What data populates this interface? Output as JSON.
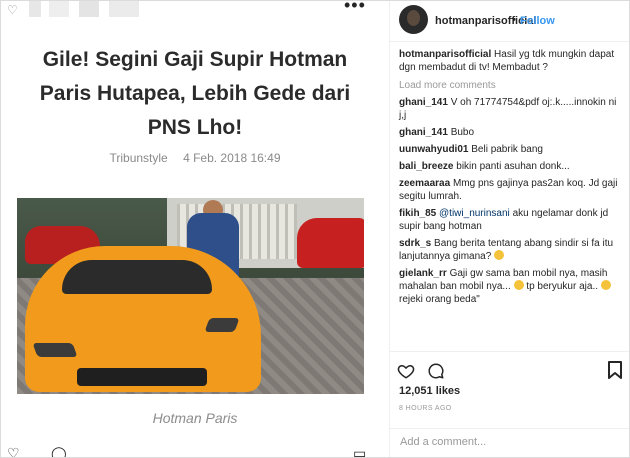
{
  "post": {
    "headline_lines": [
      "Gile! Segini Gaji Supir Hotman",
      "Paris Hutapea, Lebih Gede dari",
      "PNS Lho!"
    ],
    "source": "Tribunstyle",
    "date": "4 Feb. 2018 16:49",
    "caption": "Hotman Paris"
  },
  "header": {
    "username": "hotmanparisofficial",
    "dot": "•",
    "follow_label": "Follow"
  },
  "top_more": "•••",
  "comments": {
    "caption": {
      "user": "hotmanparisofficial",
      "text": "Hasil yg tdk mungkin dapat dgn membadut di tv! Membadut ?"
    },
    "load_more": "Load more comments",
    "items": [
      {
        "user": "ghani_141",
        "text": "V oh 71774754&pdf oj:.k.....innokin ni j,j"
      },
      {
        "user": "ghani_141",
        "text": "Bubo"
      },
      {
        "user": "uunwahyudi01",
        "text": "Beli pabrik bang"
      },
      {
        "user": "bali_breeze",
        "text": "bikin panti asuhan donk..."
      },
      {
        "user": "zeemaaraa",
        "text": "Mmg pns gajinya pas2an koq. Jd gaji segitu lumrah."
      },
      {
        "user": "fikih_85",
        "mention": "@tiwi_nurinsani",
        "text": "aku ngelamar donk jd supir bang hotman"
      },
      {
        "user": "sdrk_s",
        "text": "Bang berita tentang abang sindir si fa itu lanjutannya gimana?"
      },
      {
        "user": "gielank_rr",
        "text": "Gaji gw sama ban mobil nya, masih mahalan ban mobil nya...",
        "text2": "tp beryukur aja..",
        "text3": "rejeki orang beda\""
      }
    ]
  },
  "likes": "12,051 likes",
  "time": "8 HOURS AGO",
  "add_comment": {
    "placeholder": "Add a comment..."
  },
  "icons": {
    "heart": "heart-icon",
    "comment": "comment-icon",
    "bookmark": "bookmark-icon",
    "more": "more-options-icon"
  },
  "colors": {
    "link": "#3897f0",
    "text": "#262626",
    "muted": "#999999",
    "car": "#f29a1c"
  }
}
